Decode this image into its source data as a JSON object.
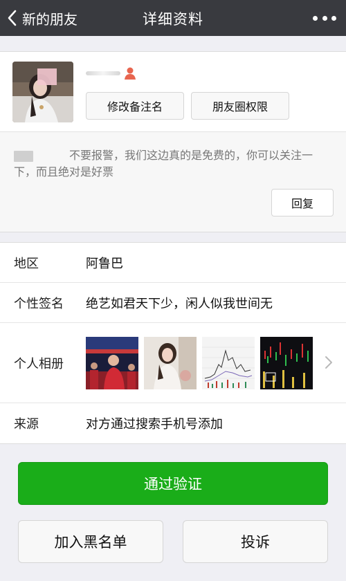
{
  "header": {
    "back_label": "新的朋友",
    "title": "详细资料",
    "more_icon": "more-dots-icon"
  },
  "profile": {
    "gender_icon": "female-contact-icon",
    "remark_button": "修改备注名",
    "moments_permission_button": "朋友圈权限"
  },
  "greeting": {
    "message": "不要报警，我们这边真的是免费的，你可以关注一下，而且绝对是好票",
    "reply_button": "回复"
  },
  "info": {
    "region_label": "地区",
    "region_value": "阿鲁巴",
    "signature_label": "个性签名",
    "signature_value": "绝艺如君天下少，闲人似我世间无",
    "album_label": "个人相册",
    "source_label": "来源",
    "source_value": "对方通过搜索手机号添加"
  },
  "actions": {
    "verify_button": "通过验证",
    "blacklist_button": "加入黑名单",
    "report_button": "投诉"
  },
  "colors": {
    "header_bg": "#393a3f",
    "primary_green": "#1aad19",
    "page_bg": "#efeff4"
  }
}
